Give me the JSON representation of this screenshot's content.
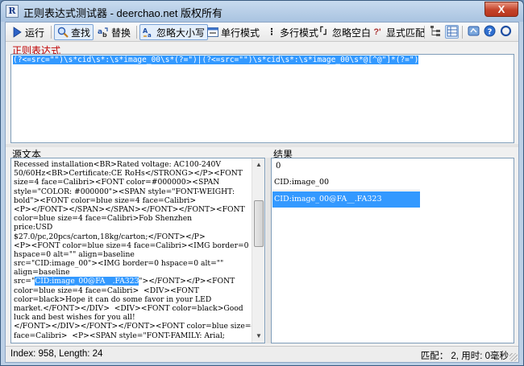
{
  "window": {
    "title": "正则表达式测试器 - deerchao.net 版权所有",
    "close_glyph": "X",
    "app_icon": "R"
  },
  "toolbar": {
    "run": {
      "label": "运行",
      "icon": "play-icon"
    },
    "find": {
      "label": "查找",
      "icon": "magnifier-icon"
    },
    "replace": {
      "label": "替换",
      "icon": "replace-icon"
    },
    "ignore_case": {
      "label": "忽略大小写",
      "icon": "case-icon",
      "checked": true
    },
    "single_line": {
      "label": "单行模式",
      "icon": "single-line-icon"
    },
    "multi_line": {
      "label": "多行模式",
      "icon": "multi-line-icon",
      "glyph": "⋮"
    },
    "ignore_whitespace": {
      "label": "忽略空白",
      "icon": "whitespace-icon",
      "glyph": "「」"
    },
    "explicit_capture": {
      "label": "显式匹配",
      "icon": "explicit-capture-icon",
      "glyph": "?'"
    }
  },
  "regex": {
    "label": "正则表达式",
    "value": "(?<=src=\"\")\\s*cid\\s*:\\s*image_00\\s*(?=\")|(?<=src=\"\")\\s*cid\\s*:\\s*image_00\\s*@[^@\"]*(?=\")"
  },
  "source": {
    "label": "源文本",
    "lines": [
      {
        "text": "Recessed installation<BR>Rated voltage: AC100-240V"
      },
      {
        "text": "50/60Hz<BR>Certificate:CE RoHs</STRONG></P><FONT"
      },
      {
        "text": "size=4 face=Calibri><FONT color=#000000><SPAN"
      },
      {
        "text": "style=\"COLOR: #000000\"><SPAN style=\"FONT-WEIGHT:"
      },
      {
        "text": "bold\"><FONT color=blue size=4 face=Calibri>"
      },
      {
        "text": "<P></FONT></SPAN></SPAN></FONT></FONT><FONT"
      },
      {
        "text": "color=blue size=4 face=Calibri>Fob Shenzhen"
      },
      {
        "text": "price:USD"
      },
      {
        "text": "$27.0/pc,20pcs/carton,18kg/carton;</FONT></P>"
      },
      {
        "text": "<P><FONT color=blue size=4 face=Calibri><IMG border=0"
      },
      {
        "text": "hspace=0 alt=\"\" align=baseline"
      },
      {
        "text": "src=\"CID:image_00\"><IMG border=0 hspace=0 alt=\"\""
      },
      {
        "text": "align=baseline"
      },
      {
        "pre": "src=\"",
        "hl": "CID:image_00@FA__.FA323",
        "post": "\"></FONT></P><FONT"
      },
      {
        "text": "color=blue size=4 face=Calibri>  <DIV><FONT"
      },
      {
        "text": "color=black>Hope it can do some favor in your LED"
      },
      {
        "text": "market.</FONT></DIV>  <DIV><FONT color=black>Good"
      },
      {
        "text": "luck and best wishes for you all!"
      },
      {
        "text": "</FONT></DIV></FONT></FONT><FONT color=blue size=4"
      },
      {
        "text": "face=Calibri>  <P><SPAN style=\"FONT-FAMILY: Arial;"
      }
    ]
  },
  "results": {
    "label": "结果",
    "root": "0",
    "items": [
      {
        "text": "CID:image_00",
        "selected": false
      },
      {
        "text": "CID:image_00@FA__.FA323",
        "selected": true
      }
    ]
  },
  "status": {
    "left": "Index: 958, Length: 24",
    "right": "匹配： 2, 用时: 0毫秒"
  }
}
